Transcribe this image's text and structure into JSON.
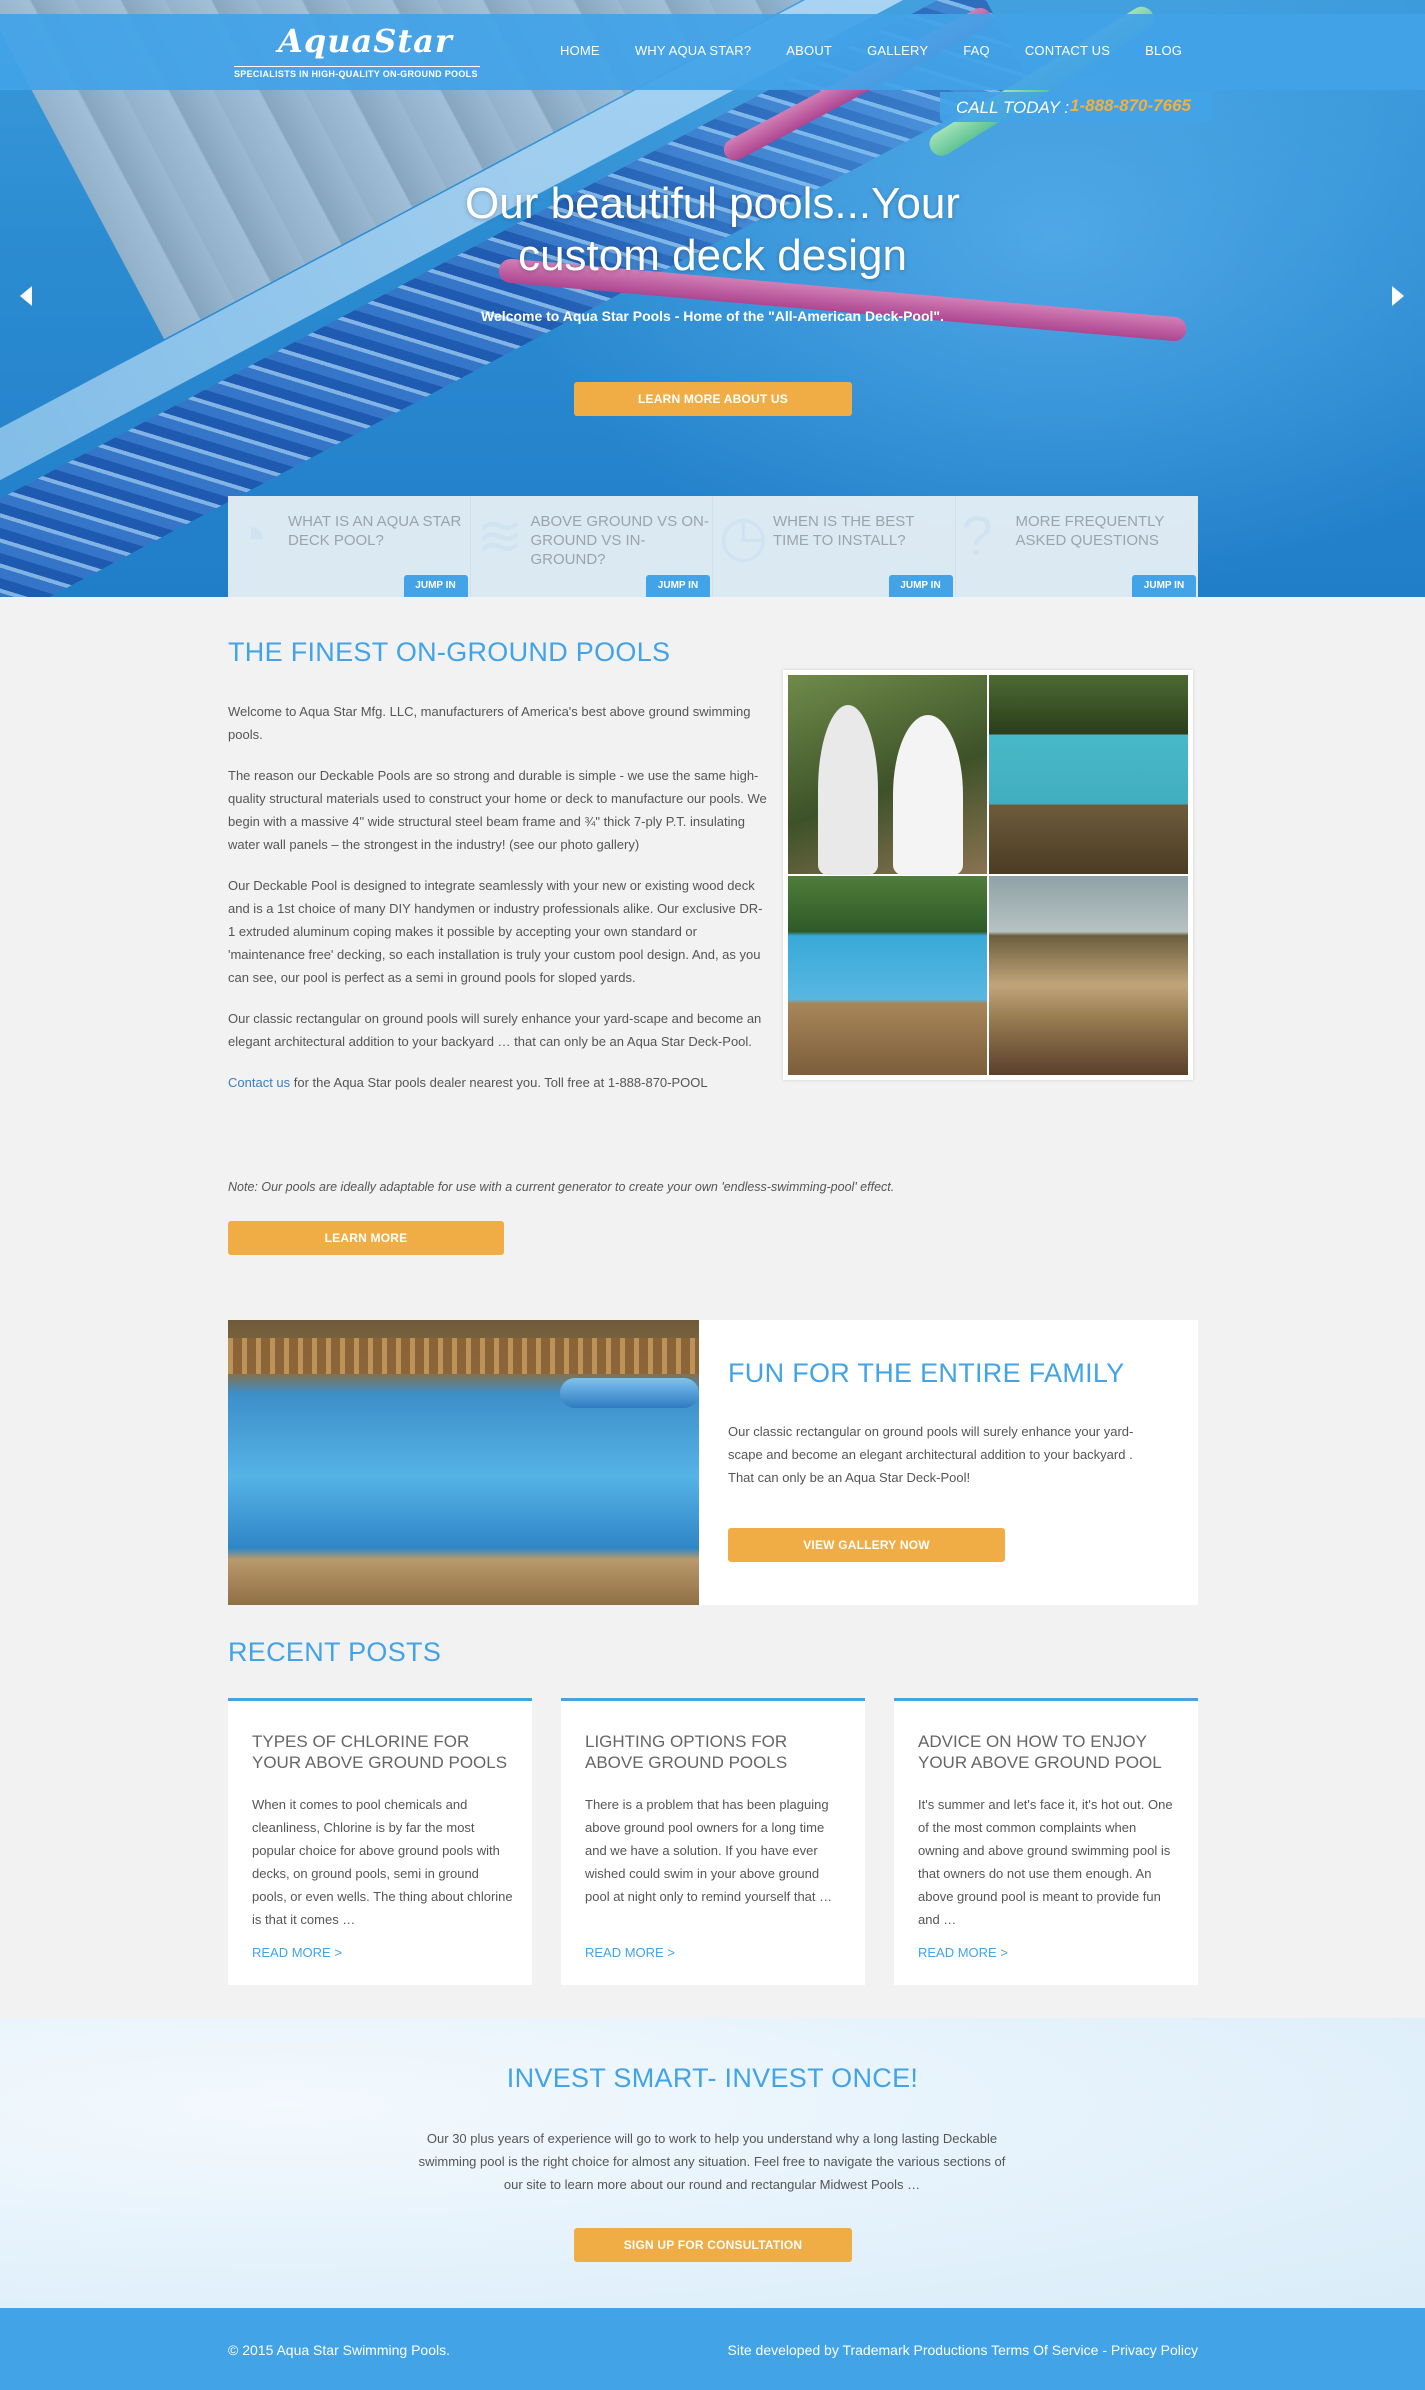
{
  "brand": {
    "name": "AquaStar",
    "tagline": "SPECIALISTS IN   HIGH-QUALITY ON-GROUND POOLS"
  },
  "nav": [
    "HOME",
    "WHY AQUA STAR?",
    "ABOUT",
    "GALLERY",
    "FAQ",
    "CONTACT US",
    "BLOG"
  ],
  "call": {
    "label": "CALL TODAY :",
    "phone": "1-888-870-7665"
  },
  "hero": {
    "title": "Our beautiful pools...Your custom deck design",
    "subtitle": "Welcome to Aqua Star Pools - Home of the \"All-American Deck-Pool\".",
    "button": "LEARN MORE ABOUT US"
  },
  "cards": [
    {
      "icon": "pool-ladder-icon",
      "text": "WHAT IS AN AQUA STAR DECK POOL?",
      "button": "JUMP IN"
    },
    {
      "icon": "water-waves-icon",
      "text": "ABOVE GROUND VS ON-GROUND VS IN-GROUND?",
      "button": "JUMP IN"
    },
    {
      "icon": "clock-icon",
      "text": "WHEN IS THE BEST TIME TO INSTALL?",
      "button": "JUMP IN"
    },
    {
      "icon": "question-mark-icon",
      "text": "MORE FREQUENTLY ASKED QUESTIONS",
      "button": "JUMP IN"
    }
  ],
  "intro": {
    "title": "THE FINEST ON-GROUND POOLS",
    "p1": "Welcome to Aqua Star Mfg. LLC, manufacturers of America's best above ground swimming pools.",
    "p2": "The reason our Deckable Pools are so strong and durable is simple - we use the same high-quality structural materials used to construct your home or deck to manufacture our pools. We begin with a massive 4\" wide structural steel beam frame and ¾\" thick 7-ply P.T. insulating water wall panels – the strongest in the industry! (see our photo gallery)",
    "p3": "Our Deckable Pool is designed to integrate seamlessly with your new or existing wood deck and is a 1st choice of many DIY handymen or industry professionals alike. Our exclusive DR-1 extruded aluminum coping makes it possible by accepting your own standard or 'maintenance free' decking, so each installation is truly your custom pool design. And, as you can see, our pool is perfect as a semi in ground pools for sloped yards.",
    "p4": "Our classic rectangular on ground pools will surely enhance your yard-scape and become an elegant architectural addition to your backyard … that can only be an Aqua Star Deck-Pool.",
    "contact_link": "Contact us",
    "contact_rest": " for the Aqua Star pools dealer nearest you. Toll free at 1-888-870-POOL",
    "note": "Note: Our pools are ideally adaptable for use with a current generator to create your own 'endless-swimming-pool' effect.",
    "button": "LEARN MORE"
  },
  "family": {
    "title": "FUN FOR THE ENTIRE FAMILY",
    "body": "Our classic rectangular on ground pools will surely enhance your yard-scape and become an elegant architectural addition to your backyard . That can only be an Aqua Star Deck-Pool!",
    "button": "VIEW GALLERY NOW"
  },
  "posts": {
    "title": "RECENT POSTS",
    "items": [
      {
        "title": "TYPES OF CHLORINE FOR YOUR ABOVE GROUND POOLS",
        "body": "When it comes to pool chemicals and cleanliness, Chlorine is by far the most popular choice for above ground pools with decks, on ground pools, semi in ground pools, or even wells. The thing about chlorine is that it comes …",
        "more": "READ MORE >"
      },
      {
        "title": "LIGHTING OPTIONS FOR ABOVE GROUND POOLS",
        "body": "There is a problem that has been plaguing above ground pool owners for a long time and we have a solution. If you have ever wished could swim in your above ground pool at night only to remind yourself that …",
        "more": "READ MORE >"
      },
      {
        "title": "ADVICE ON HOW TO ENJOY YOUR ABOVE GROUND POOL",
        "body": "It's summer and let's face it, it's hot out. One of the most common complaints when owning and above ground swimming pool is that owners do not use them enough. An above ground pool is meant to provide fun and …",
        "more": "READ MORE >"
      }
    ]
  },
  "invest": {
    "title": "INVEST SMART- INVEST ONCE!",
    "body": "Our 30 plus years of experience will go to work to help you understand why a long lasting Deckable swimming pool is the right choice for almost any situation. Feel free to navigate the various sections of our site to learn more about our round and rectangular Midwest Pools …",
    "button": "SIGN UP FOR CONSULTATION"
  },
  "footer": {
    "copyright": "© 2015 Aqua Star Swimming Pools.",
    "credits": "Site developed by Trademark Productions Terms Of Service - Privacy Policy"
  },
  "colors": {
    "accent": "#42a3e7",
    "button": "#f0ad45"
  }
}
